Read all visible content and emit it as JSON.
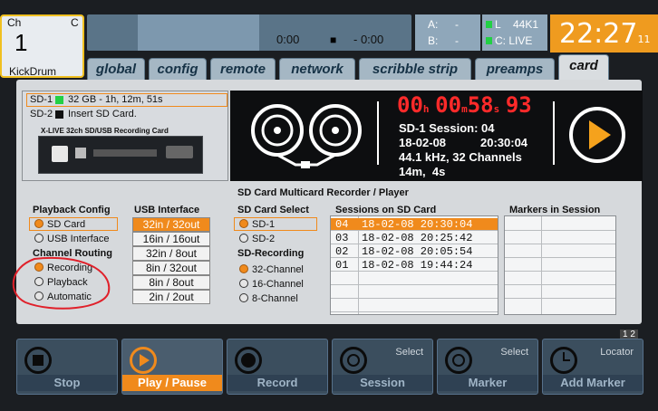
{
  "channel": {
    "ch_label": "Ch",
    "c_label": "C",
    "number": "1",
    "name": "KickDrum"
  },
  "transport_times": {
    "elapsed": "0:00",
    "stop_glyph": "■",
    "remaining": "- 0:00"
  },
  "bus_a": {
    "a": "A:",
    "a_val": "-",
    "b": "B:",
    "b_val": "-"
  },
  "bus_b": {
    "l": "L",
    "rate": "44K1",
    "c": "C: LIVE"
  },
  "clock": {
    "time": "22:27",
    "seconds": "11"
  },
  "tabs": [
    {
      "label": "global"
    },
    {
      "label": "config"
    },
    {
      "label": "remote"
    },
    {
      "label": "network"
    },
    {
      "label": "scribble strip"
    },
    {
      "label": "preamps"
    },
    {
      "label": "card"
    }
  ],
  "sd": {
    "sd1_label": "SD-1",
    "sd1_info": "32 GB - 1h, 12m, 51s",
    "sd2_label": "SD-2",
    "sd2_info": "Insert SD Card.",
    "card_title": "X-LIVE 32ch SD/USB Recording Card"
  },
  "display": {
    "h": "00",
    "m": "00",
    "s": "58",
    "f": "93",
    "session": "SD-1 Session: 04",
    "date": "18-02-08",
    "clock": "20:30:04",
    "format": "44.1 kHz, 32 Channels",
    "length": "14m,  4s"
  },
  "section_title": "SD Card Multicard Recorder / Player",
  "playback_config": {
    "title": "Playback Config",
    "options": [
      "SD Card",
      "USB Interface"
    ],
    "selected": 0
  },
  "channel_routing": {
    "title": "Channel Routing",
    "options": [
      "Recording",
      "Playback",
      "Automatic"
    ],
    "selected": 0
  },
  "usb_interface": {
    "title": "USB Interface",
    "options": [
      "32in / 32out",
      "16in / 16out",
      "32in / 8out",
      "8in / 32out",
      "8in / 8out",
      "2in / 2out"
    ],
    "selected": 0
  },
  "sd_card_select": {
    "title": "SD Card Select",
    "options": [
      "SD-1",
      "SD-2"
    ],
    "selected": 0
  },
  "sd_recording": {
    "title": "SD-Recording",
    "options": [
      "32-Channel",
      "16-Channel",
      "8-Channel"
    ],
    "selected": 0
  },
  "sessions": {
    "title": "Sessions on SD Card",
    "rows": [
      {
        "num": "04",
        "date": "18-02-08 20:30:04",
        "selected": true
      },
      {
        "num": "03",
        "date": "18-02-08 20:25:42",
        "selected": false
      },
      {
        "num": "02",
        "date": "18-02-08 20:05:54",
        "selected": false
      },
      {
        "num": "01",
        "date": "18-02-08 19:44:24",
        "selected": false
      }
    ]
  },
  "markers": {
    "title": "Markers in Session"
  },
  "page_indicator": "1 2",
  "buttons": [
    {
      "label": "Stop",
      "caption": ""
    },
    {
      "label": "Play / Pause",
      "caption": ""
    },
    {
      "label": "Record",
      "caption": ""
    },
    {
      "label": "Session",
      "caption": "Select"
    },
    {
      "label": "Marker",
      "caption": "Select"
    },
    {
      "label": "Add Marker",
      "caption": "Locator"
    }
  ],
  "colors": {
    "accent": "#f08a1c",
    "clock_bg": "#ef9b1f",
    "led_green": "#22d044",
    "seg_red": "#ff2a2a",
    "annotation": "#e0202a"
  }
}
